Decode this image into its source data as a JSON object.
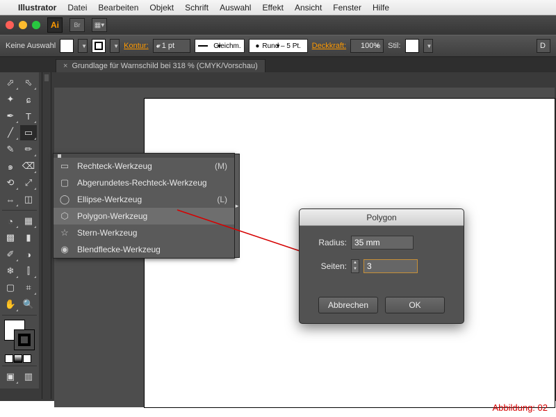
{
  "menubar": {
    "app": "Illustrator",
    "items": [
      "Datei",
      "Bearbeiten",
      "Objekt",
      "Schrift",
      "Auswahl",
      "Effekt",
      "Ansicht",
      "Fenster",
      "Hilfe"
    ]
  },
  "optbar": {
    "selection": "Keine Auswahl",
    "kontur_label": "Kontur:",
    "stroke_weight": "1 pt",
    "stroke_dash": "Gleichm.",
    "brush": "Rund – 5 Pt.",
    "opacity_label": "Deckkraft:",
    "opacity": "100%",
    "style_label": "Stil:"
  },
  "doc_tab": "Grundlage für Warnschild bei 318 % (CMYK/Vorschau)",
  "flyout": {
    "items": [
      {
        "icon": "▭",
        "label": "Rechteck-Werkzeug",
        "shortcut": "(M)"
      },
      {
        "icon": "▢",
        "label": "Abgerundetes-Rechteck-Werkzeug",
        "shortcut": ""
      },
      {
        "icon": "◯",
        "label": "Ellipse-Werkzeug",
        "shortcut": "(L)"
      },
      {
        "icon": "⬡",
        "label": "Polygon-Werkzeug",
        "shortcut": ""
      },
      {
        "icon": "☆",
        "label": "Stern-Werkzeug",
        "shortcut": ""
      },
      {
        "icon": "◉",
        "label": "Blendflecke-Werkzeug",
        "shortcut": ""
      }
    ],
    "hover_index": 3
  },
  "dialog": {
    "title": "Polygon",
    "radius_label": "Radius:",
    "radius_value": "35 mm",
    "sides_label": "Seiten:",
    "sides_value": "3",
    "cancel": "Abbrechen",
    "ok": "OK"
  },
  "caption": "Abbildung: 02"
}
